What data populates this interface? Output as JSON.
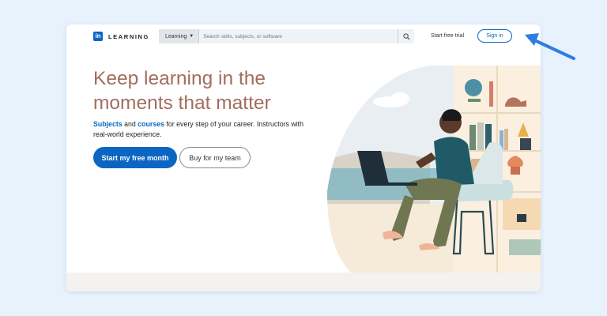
{
  "header": {
    "logo_mark": "in",
    "logo_text": "LEARNING",
    "search": {
      "category": "Learning",
      "placeholder": "Search skills, subjects, or software"
    },
    "start_trial": "Start free trial",
    "sign_in": "Sign in"
  },
  "hero": {
    "headline": "Keep learning in the moments that matter",
    "subtitle_link_1": "Subjects",
    "subtitle_and": " and ",
    "subtitle_link_2": "courses",
    "subtitle_rest": " for every step of your career. Instructors with real-world experience.",
    "primary_button": "Start my free month",
    "secondary_button": "Buy for my team"
  },
  "colors": {
    "background": "#e8f2fd",
    "brand_blue": "#0a66c2",
    "headline": "#a06e5d",
    "arrow": "#2f7de1"
  },
  "icons": {
    "search": "search-icon",
    "caret": "caret-down-icon",
    "annotation": "arrow-pointer-icon"
  }
}
